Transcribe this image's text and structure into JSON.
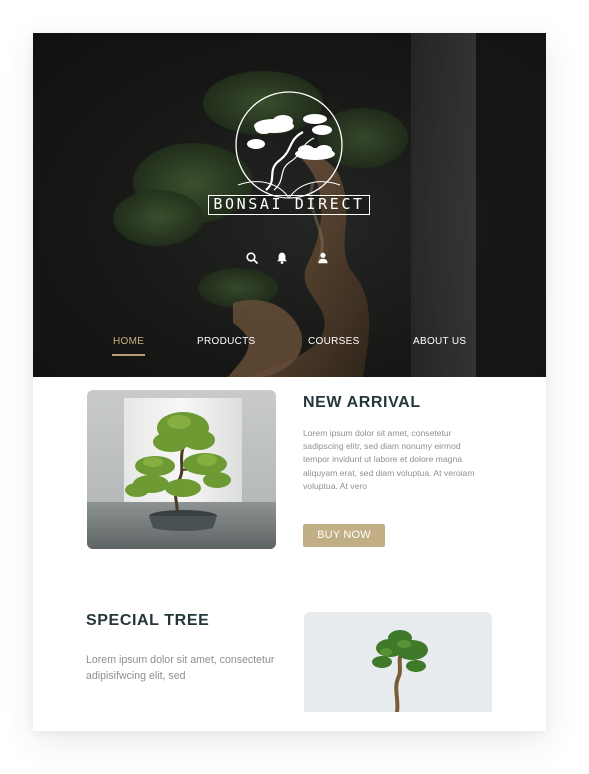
{
  "brand": {
    "name": "BONSAI DIRECT"
  },
  "header_icons": [
    "search-icon",
    "bell-icon",
    "user-icon"
  ],
  "nav": {
    "items": [
      {
        "label": "HOME",
        "active": true
      },
      {
        "label": "PRODUCTS",
        "active": false
      },
      {
        "label": "COURSES",
        "active": false
      },
      {
        "label": "ABOUT US",
        "active": false
      }
    ]
  },
  "new_arrival": {
    "title": "NEW ARRIVAL",
    "body": "Lorem ipsum dolor sit amet, consetetur sadipscing elitr, sed diam nonumy eirmod tempor invidunt ut labore et dolore magna aliquyam erat, sed diam voluptua. At veroiam voluptua. At vero",
    "button_label": "BUY NOW"
  },
  "special_tree": {
    "title": "SPECIAL TREE",
    "body": "Lorem ipsum dolor sit amet, consectetur adipisifwcing elit, sed"
  },
  "colors": {
    "accent": "#c2ae84",
    "heading": "#24373b",
    "body_text": "#8c9095",
    "nav_active": "#c8b27f",
    "hero_bg": "#1c1d1b"
  }
}
